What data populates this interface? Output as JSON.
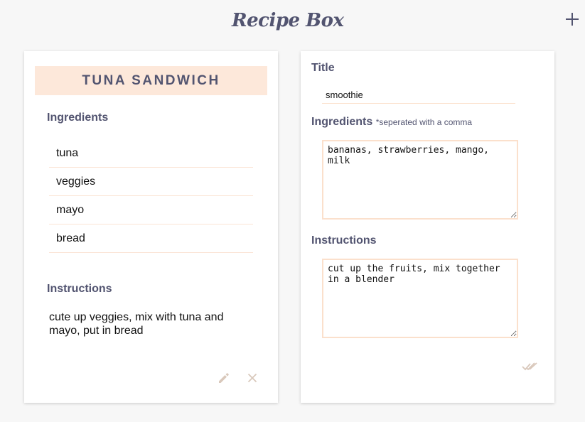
{
  "app": {
    "title": "Recipe Box",
    "add_icon": "plus-icon"
  },
  "recipe_card": {
    "title": "TUNA SANDWICH",
    "ingredients_label": "Ingredients",
    "ingredients": [
      "tuna",
      "veggies",
      "mayo",
      "bread"
    ],
    "instructions_label": "Instructions",
    "instructions": "cute up veggies, mix with tuna and mayo, put in bread",
    "edit_icon": "pencil-icon",
    "delete_icon": "close-icon"
  },
  "edit_form": {
    "title_label": "Title",
    "title_value": "smoothie",
    "ingredients_label": "Ingredients",
    "ingredients_hint": "*seperated with a comma",
    "ingredients_value": "bananas, strawberries, mango, milk",
    "instructions_label": "Instructions",
    "instructions_value": "cut up the fruits, mix together in a blender",
    "save_icon": "double-check-icon"
  },
  "colors": {
    "accent": "#fde8da",
    "text_primary": "#525470",
    "border": "#fbe0cc",
    "icon": "#d9c8bb",
    "background": "#f7f7f7"
  }
}
